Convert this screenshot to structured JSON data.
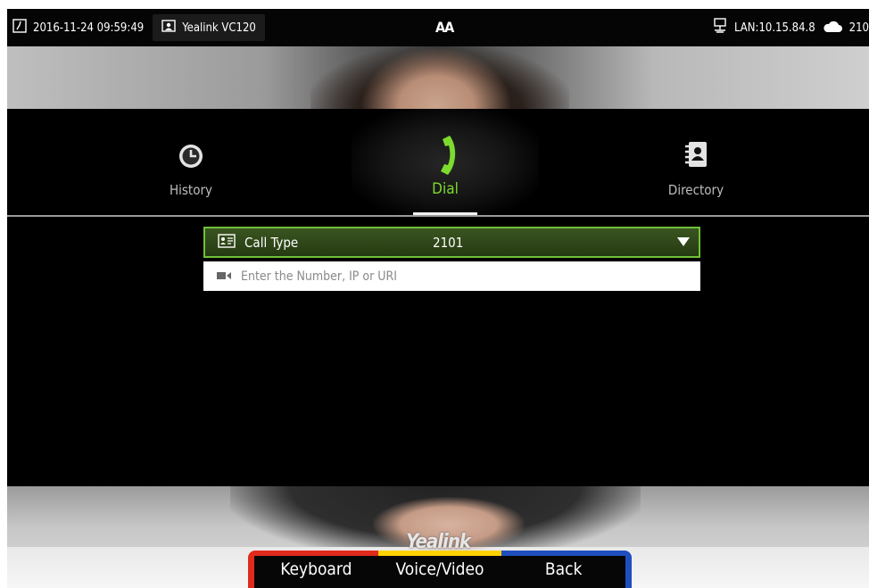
{
  "status_bar": {
    "datetime": "2016-11-24 09:59:49",
    "device_name": "Yealink VC120",
    "center_glyph": "AA",
    "lan": "LAN:10.15.84.8",
    "account": "210"
  },
  "tabs": [
    {
      "label": "History",
      "icon": "clock-icon"
    },
    {
      "label": "Dial",
      "icon": "phone-icon",
      "active": true
    },
    {
      "label": "Directory",
      "icon": "contact-book-icon"
    }
  ],
  "call_type": {
    "label": "Call Type",
    "value": "2101"
  },
  "number_input": {
    "value": "",
    "placeholder": "Enter the Number, IP or URI"
  },
  "video": {
    "brand": "Yealink"
  },
  "softkeys": [
    {
      "label": "Keyboard",
      "color": "#e02a1c"
    },
    {
      "label": "Voice/Video",
      "color": "#ffd200"
    },
    {
      "label": "Back",
      "color": "#1f4fbf"
    }
  ],
  "colors": {
    "accent": "#7ddb2e",
    "selection_border": "#6fc13a"
  }
}
